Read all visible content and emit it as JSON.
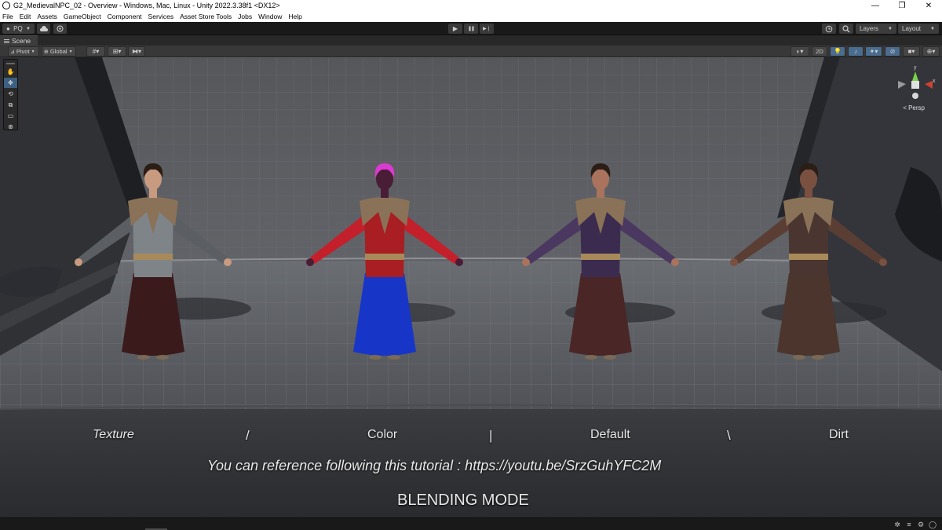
{
  "window": {
    "title": "G2_MedievalNPC_02 - Overview - Windows, Mac, Linux - Unity 2022.3.38f1 <DX12>",
    "controls": {
      "minimize": "—",
      "restore": "❐",
      "close": "✕"
    }
  },
  "menubar": {
    "items": [
      "File",
      "Edit",
      "Assets",
      "GameObject",
      "Component",
      "Services",
      "Asset Store Tools",
      "Jobs",
      "Window",
      "Help"
    ]
  },
  "toolbar": {
    "account_label": "PQ",
    "layers_label": "Layers",
    "layout_label": "Layout",
    "play_glyph": "▶",
    "pause_glyph": "❚❚",
    "step_glyph": "▶❘"
  },
  "scene": {
    "tab_label": "Scene",
    "pivot_label": "Pivot",
    "global_label": "Global",
    "mode_2d_label": "2D",
    "persp_label": "Persp",
    "gizmo_axes": {
      "y": "y",
      "x": "x"
    }
  },
  "tools": [
    "hand-tool",
    "move-tool",
    "rotate-tool",
    "scale-tool",
    "rect-tool",
    "transform-tool"
  ],
  "overlay": {
    "label_texture": "Texture",
    "sep_1": "/",
    "label_color": "Color",
    "sep_2": "|",
    "label_default": "Default",
    "sep_3": "\\",
    "label_dirt": "Dirt",
    "tutorial_line": "You can reference following this tutorial : https://youtu.be/SrzGuhYFC2M",
    "mode_title": "BLENDING MODE"
  },
  "characters": [
    {
      "variant": "texture",
      "bodice": "#7f8489",
      "sleeve": "#5b5f64",
      "skirt": "#3b1a1c",
      "hair": "#2a1e16",
      "skin": "#c89a80"
    },
    {
      "variant": "color",
      "bodice": "#a81e22",
      "sleeve": "#c4202c",
      "skirt": "#1736c7",
      "hair": "#d93ad0",
      "skin": "#4a1d36"
    },
    {
      "variant": "default",
      "bodice": "#3b2c4f",
      "sleeve": "#4a3860",
      "skirt": "#4a2626",
      "hair": "#2a1e16",
      "skin": "#a9735d"
    },
    {
      "variant": "dirt",
      "bodice": "#4a3530",
      "sleeve": "#5a3e34",
      "skirt": "#4b352d",
      "hair": "#2a1e16",
      "skin": "#7a5040"
    }
  ],
  "colors": {
    "editor_bg": "#191919",
    "accent_blue": "#3d5f82",
    "gizmo_y": "#7ad14a",
    "gizmo_x": "#d0422f",
    "gizmo_z": "#4a7ad1"
  }
}
